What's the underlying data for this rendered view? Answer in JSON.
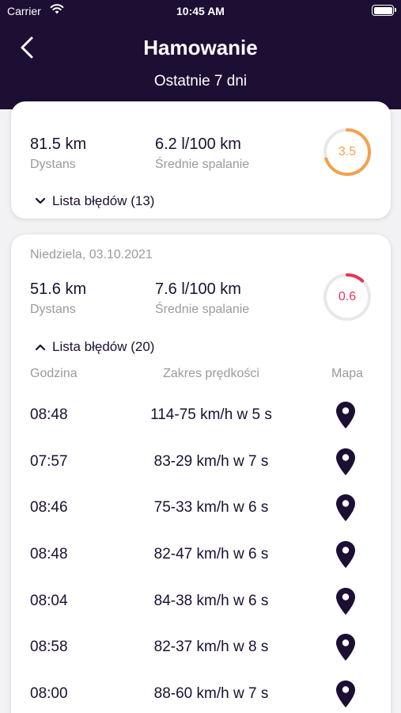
{
  "status_bar": {
    "carrier": "Carrier",
    "time": "10:45 AM"
  },
  "nav": {
    "title": "Hamowanie",
    "subtitle": "Ostatnie 7 dni"
  },
  "colors": {
    "header_bg": "#1c0f33",
    "score_orange": "#f4a14b",
    "score_red": "#e8345a",
    "gauge_track": "#e8e8ea"
  },
  "cards": [
    {
      "date": "",
      "distance": "81.5 km",
      "distance_label": "Dystans",
      "fuel": "6.2 l/100 km",
      "fuel_label": "Średnie spalanie",
      "score": "3.5",
      "score_fraction": 0.7,
      "toggle_label": "Lista błędów (13)",
      "expanded": false
    },
    {
      "date": "Niedziela, 03.10.2021",
      "distance": "51.6 km",
      "distance_label": "Dystans",
      "fuel": "7.6 l/100 km",
      "fuel_label": "Średnie spalanie",
      "score": "0.6",
      "score_fraction": 0.12,
      "toggle_label": "Lista błędów (20)",
      "expanded": true,
      "columns": {
        "time": "Godzina",
        "range": "Zakres prędkości",
        "map": "Mapa"
      },
      "events": [
        {
          "time": "08:48",
          "range": "114-75 km/h w 5 s"
        },
        {
          "time": "07:57",
          "range": "83-29 km/h w 7 s"
        },
        {
          "time": "08:46",
          "range": "75-33 km/h w 6 s"
        },
        {
          "time": "08:48",
          "range": "82-47 km/h w 6 s"
        },
        {
          "time": "08:04",
          "range": "84-38 km/h w 6 s"
        },
        {
          "time": "08:58",
          "range": "82-37 km/h w 8 s"
        },
        {
          "time": "08:00",
          "range": "88-60 km/h w 7 s"
        }
      ]
    }
  ]
}
